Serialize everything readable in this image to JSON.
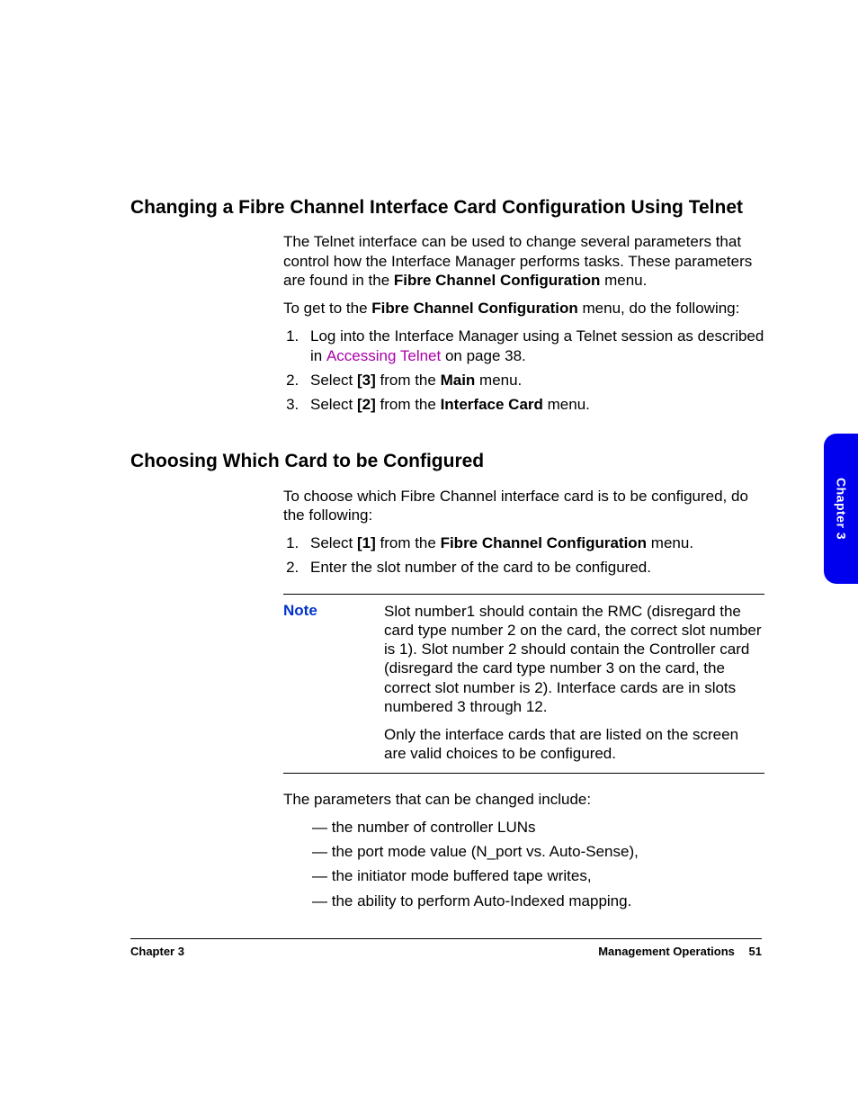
{
  "sections": [
    {
      "heading": "Changing a Fibre Channel Interface Card Configuration Using Telnet",
      "intro_parts": {
        "pre": "The Telnet interface can be used to change several parameters that control how the Interface Manager performs tasks. These parameters are found in the ",
        "bold": "Fibre Channel Configuration",
        "post": " menu."
      },
      "lead_parts": {
        "pre": "To get to the ",
        "bold": "Fibre Channel Configuration",
        "post": " menu, do the following:"
      },
      "steps": [
        {
          "pre": "Log into the Interface Manager using a Telnet session as described in ",
          "link": "Accessing Telnet",
          "post": " on page 38."
        },
        {
          "pre": "Select ",
          "bold1": "[3]",
          "mid": "  from the ",
          "bold2": "Main",
          "post": " menu."
        },
        {
          "pre": "Select ",
          "bold1": "[2]",
          "mid": " from the ",
          "bold2": "Interface Card",
          "post": " menu."
        }
      ]
    },
    {
      "heading": "Choosing Which Card to be Configured",
      "intro_plain": "To choose which Fibre Channel interface card is to be configured, do the following:",
      "steps": [
        {
          "pre": "Select  ",
          "bold1": "[1]",
          "mid": " from the ",
          "bold2": "Fibre Channel Configuration",
          "post": " menu."
        },
        {
          "pre": "Enter the slot number of the card to be configured."
        }
      ],
      "note": {
        "label": "Note",
        "paragraphs": [
          "Slot number1 should contain the RMC (disregard the card type number 2 on the card, the correct slot number is 1). Slot number 2 should contain the Controller card (disregard the card type number 3 on the card, the correct slot number is 2). Interface cards are in slots numbered 3 through 12.",
          "Only the interface cards that are listed on the screen are valid choices to be configured."
        ]
      },
      "after_note": "The parameters that can be changed include:",
      "bullets": [
        "the number of controller LUNs",
        "the port mode value (N_port vs. Auto-Sense),",
        "the initiator mode buffered tape writes,",
        "the ability to perform Auto-Indexed mapping."
      ]
    }
  ],
  "side_tab": "Chapter 3",
  "footer": {
    "left": "Chapter 3",
    "right_title": "Management Operations",
    "page_number": "51"
  }
}
